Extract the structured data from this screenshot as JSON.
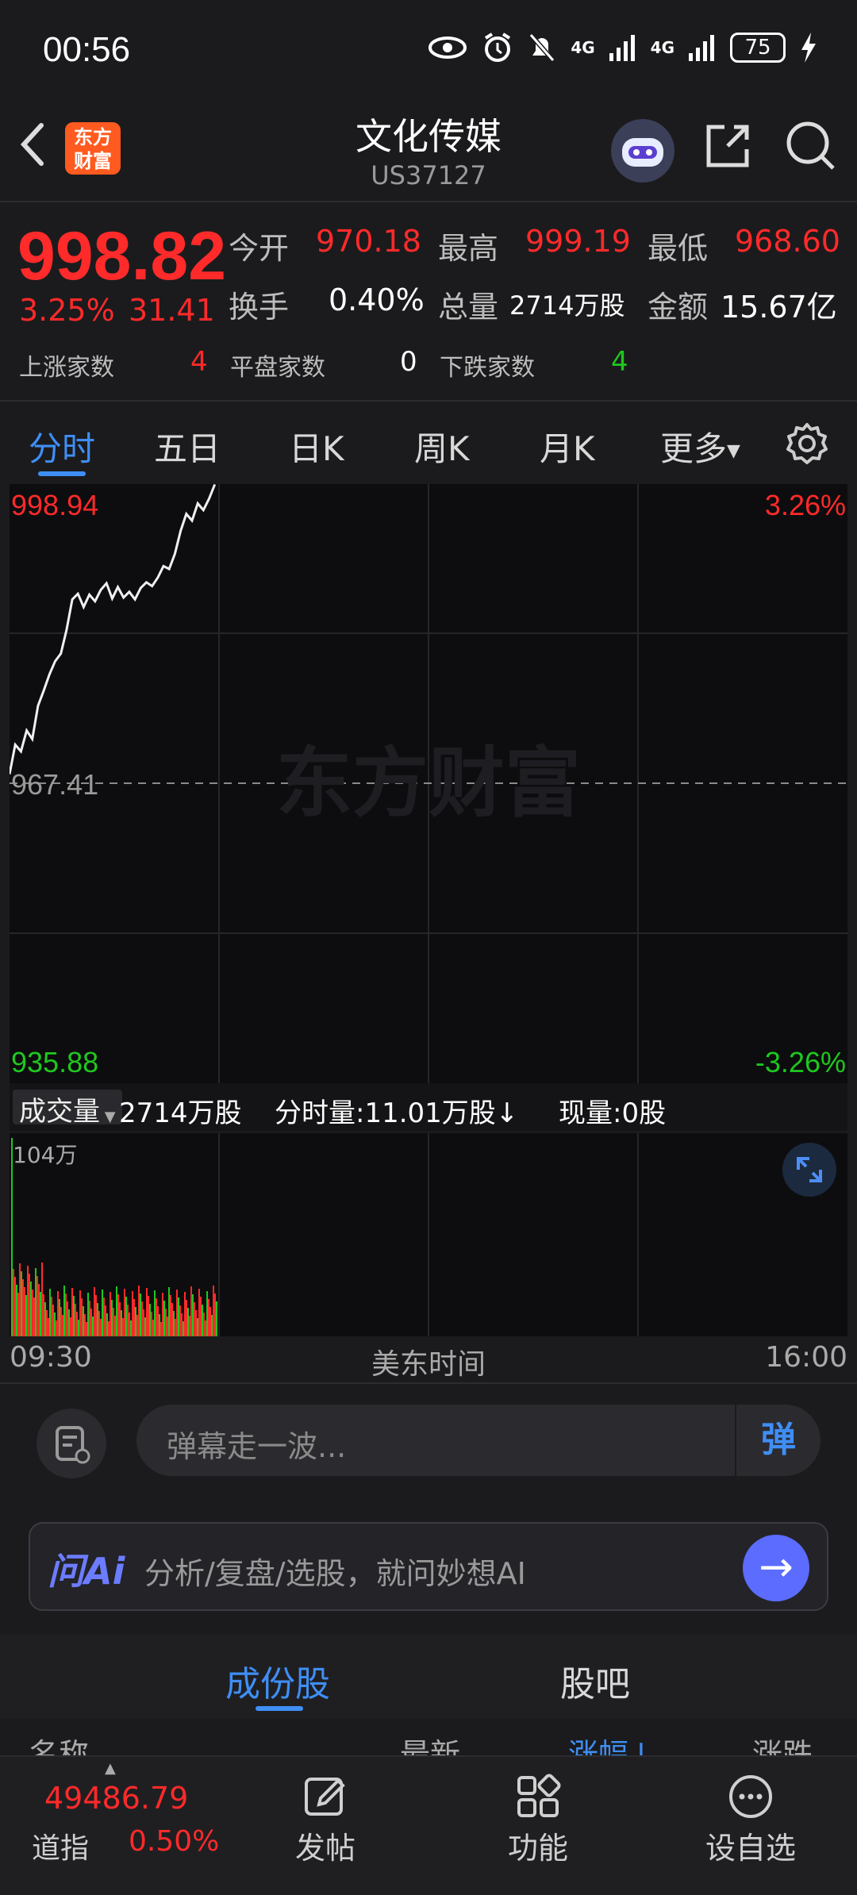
{
  "status_bar": {
    "time": "00:56",
    "network1": "4G",
    "network2": "4G",
    "battery": "75"
  },
  "header": {
    "logo_text": "东方财富",
    "title": "文化传媒",
    "code": "US37127"
  },
  "quote": {
    "price": "998.82",
    "change_pct": "3.25%",
    "change_amt": "31.41",
    "open_label": "今开",
    "open": "970.18",
    "high_label": "最高",
    "high": "999.19",
    "low_label": "最低",
    "low": "968.60",
    "turnover_label": "换手",
    "turnover": "0.40%",
    "volume_label": "总量",
    "volume": "2714万股",
    "amount_label": "金额",
    "amount": "15.67亿",
    "up_label": "上涨家数",
    "up_count": "4",
    "flat_label": "平盘家数",
    "flat_count": "0",
    "down_label": "下跌家数",
    "down_count": "4"
  },
  "tabs": [
    {
      "label": "分时",
      "active": true
    },
    {
      "label": "五日"
    },
    {
      "label": "日K"
    },
    {
      "label": "周K"
    },
    {
      "label": "月K"
    },
    {
      "label": "更多"
    }
  ],
  "chart_labels": {
    "top_price": "998.94",
    "top_pct": "3.26%",
    "mid_price": "967.41",
    "bottom_price": "935.88",
    "bottom_pct": "-3.26%",
    "watermark": "东方财富",
    "vol_selector": "成交量",
    "vol_total": "2714万股",
    "vol_minute": "分时量:11.01万股↓",
    "vol_current": "现量:0股",
    "vol_max": "104万",
    "time_start": "09:30",
    "time_mid": "美东时间",
    "time_end": "16:00"
  },
  "chart_data": {
    "type": "line",
    "title": "",
    "ylim": [
      935.88,
      998.94
    ],
    "x_range": [
      "09:30",
      "16:00"
    ],
    "baseline": 967.41,
    "series": [
      {
        "values": [
          968.4,
          971.5,
          970.8,
          973.0,
          972.1,
          975.6,
          977.2,
          978.9,
          980.3,
          981.1,
          983.6,
          986.8,
          987.4,
          986.0,
          987.3,
          986.6,
          987.8,
          988.5,
          986.9,
          988.1,
          987.0,
          987.6,
          986.8,
          988.0,
          988.6,
          988.2,
          989.1,
          990.3,
          990.0,
          991.6,
          994.0,
          995.8,
          995.1,
          996.9,
          996.2,
          997.4,
          998.9
        ]
      }
    ],
    "volume_max_label": "104万"
  },
  "comment": {
    "placeholder": "弹幕走一波...",
    "danmu_label": "弹"
  },
  "ai": {
    "logo": "问Ai",
    "prompt": "分析/复盘/选股，就问妙想AI"
  },
  "subtabs": {
    "constituents": "成份股",
    "forum": "股吧"
  },
  "list_header": {
    "name": "名称",
    "latest": "最新",
    "change_pct": "涨幅↓",
    "change": "涨跌"
  },
  "bottom_nav": {
    "index_value": "49486.79",
    "index_name": "道指",
    "index_pct": "0.50%",
    "post": "发帖",
    "functions": "功能",
    "watchlist": "设自选"
  }
}
